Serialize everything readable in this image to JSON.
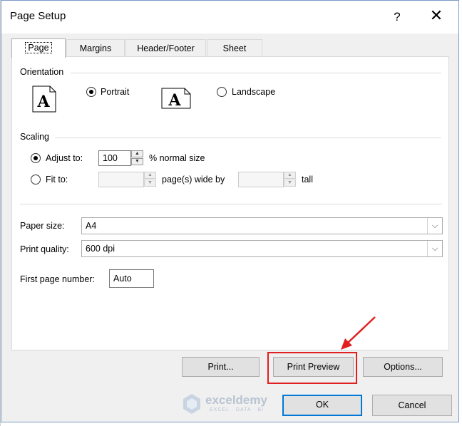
{
  "window": {
    "title": "Page Setup",
    "help_glyph": "?",
    "close_glyph": "✕"
  },
  "tabs": [
    {
      "label": "Page",
      "active": true
    },
    {
      "label": "Margins",
      "active": false
    },
    {
      "label": "Header/Footer",
      "active": false
    },
    {
      "label": "Sheet",
      "active": false
    }
  ],
  "orientation": {
    "heading": "Orientation",
    "portrait_label": "Portrait",
    "landscape_label": "Landscape",
    "selected": "portrait",
    "portrait_glyph": "A",
    "landscape_glyph": "A"
  },
  "scaling": {
    "heading": "Scaling",
    "adjust_label": "Adjust to:",
    "adjust_value": "100",
    "adjust_suffix": "% normal size",
    "fit_label": "Fit to:",
    "fit_wide_value": "",
    "fit_wide_suffix": "page(s) wide by",
    "fit_tall_value": "",
    "fit_tall_suffix": "tall",
    "selected": "adjust"
  },
  "paper_size": {
    "label": "Paper size:",
    "value": "A4"
  },
  "print_quality": {
    "label": "Print quality:",
    "value": "600 dpi"
  },
  "first_page": {
    "label": "First page number:",
    "value": "Auto"
  },
  "buttons": {
    "print": "Print...",
    "print_preview": "Print Preview",
    "options": "Options...",
    "ok": "OK",
    "cancel": "Cancel"
  },
  "watermark": {
    "brand": "exceldemy",
    "tagline": "EXCEL · DATA · BI"
  },
  "colors": {
    "highlight": "#e02020",
    "default_button_border": "#0078d7"
  },
  "icons": {
    "spin_up": "▲",
    "spin_down": "▼",
    "dropdown": "⌵"
  }
}
